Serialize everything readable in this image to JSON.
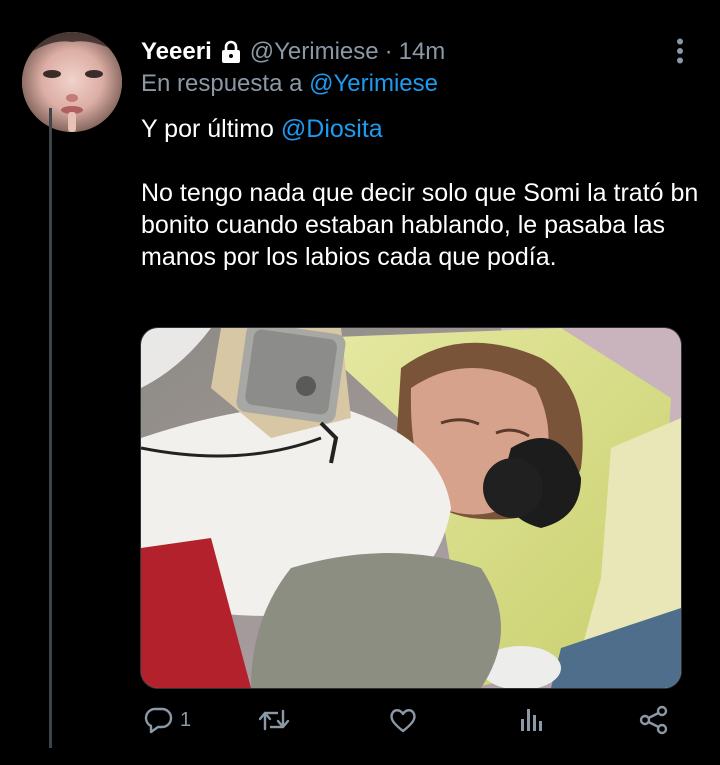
{
  "tweet": {
    "display_name": "Yeeeri",
    "handle": "@Yerimiese",
    "separator": "·",
    "time": "14m",
    "reply_prefix": "En respuesta a",
    "reply_mention": "@Yerimiese",
    "line1_text": "Y por último",
    "line1_mention": "@Diosita",
    "paragraph": "No tengo nada que decir solo que Somi la trató bn bonito cuando estaban hablando, le pasaba las manos por los labios cada que podía.",
    "reply_count": "1"
  },
  "icons": {
    "verified_lock": "lock-icon",
    "more": "more-vertical-icon",
    "reply": "reply-icon",
    "retweet": "retweet-icon",
    "like": "heart-icon",
    "analytics": "analytics-icon",
    "share": "share-icon"
  },
  "colors": {
    "background": "#000000",
    "text": "#ffffff",
    "secondary": "#8b98a5",
    "accent": "#1d9bf0",
    "thread_line": "#3d4449"
  }
}
